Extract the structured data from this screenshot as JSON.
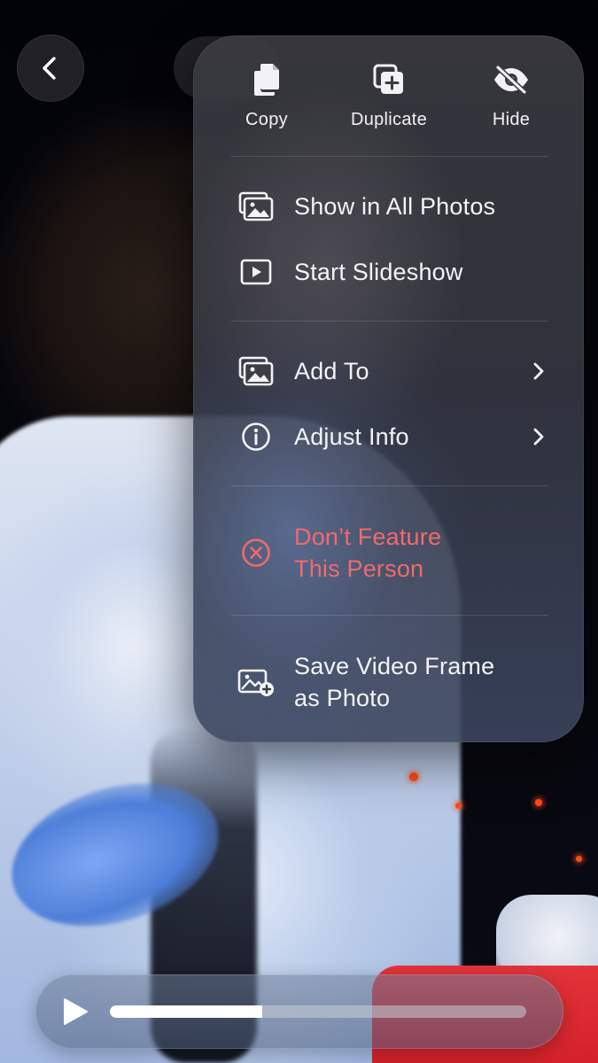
{
  "header": {
    "back_icon": "chevron-left-icon"
  },
  "menu": {
    "quick_actions": [
      {
        "label": "Copy",
        "icon": "copy-icon"
      },
      {
        "label": "Duplicate",
        "icon": "duplicate-icon"
      },
      {
        "label": "Hide",
        "icon": "eye-slash-icon"
      }
    ],
    "items": [
      {
        "label": "Show in All Photos",
        "icon": "photos-stack-icon"
      },
      {
        "label": "Start Slideshow",
        "icon": "play-rectangle-icon"
      },
      {
        "label": "Add To",
        "icon": "photos-stack-icon",
        "has_submenu": true
      },
      {
        "label": "Adjust Info",
        "icon": "info-circle-icon",
        "has_submenu": true
      },
      {
        "label_line1": "Don’t Feature",
        "label_line2": "This Person",
        "icon": "x-circle-icon",
        "destructive": true
      },
      {
        "label_line1": "Save Video Frame",
        "label_line2": "as Photo",
        "icon": "photo-plus-icon"
      }
    ]
  },
  "player": {
    "play_icon": "play-icon",
    "progress": 0.365
  },
  "colors": {
    "destructive": "#f06a6e",
    "menu_text": "#f4f4f6",
    "scrubber_fill": "#ffffff"
  }
}
